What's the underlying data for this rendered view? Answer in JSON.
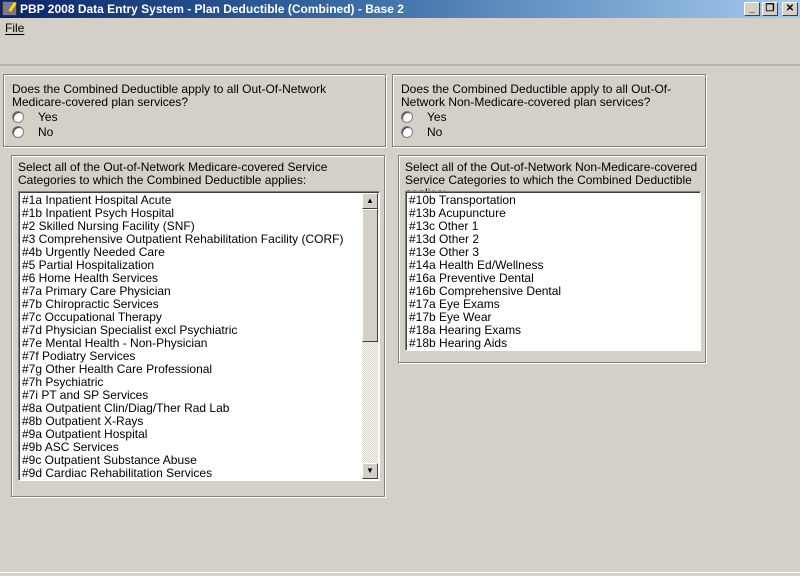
{
  "window": {
    "title": "PBP 2008 Data Entry System - Plan Deductible (Combined) - Base 2",
    "minimize": "_",
    "restore": "❐",
    "close": "✕"
  },
  "menu": {
    "file": "File"
  },
  "q_medicare": {
    "question": "Does the Combined Deductible apply to all Out-Of-Network Medicare-covered plan services?",
    "yes": "Yes",
    "no": "No"
  },
  "q_nonmedicare": {
    "question": "Does the Combined Deductible apply to all Out-Of-Network Non-Medicare-covered plan services?",
    "yes": "Yes",
    "no": "No"
  },
  "list_medicare": {
    "label": "Select all of the Out-of-Network Medicare-covered Service Categories to which the Combined Deductible applies:",
    "items": [
      "#1a Inpatient Hospital Acute",
      "#1b Inpatient Psych Hospital",
      "#2 Skilled Nursing Facility (SNF)",
      "#3 Comprehensive Outpatient Rehabilitation Facility (CORF)",
      "#4b Urgently Needed Care",
      "#5 Partial Hospitalization",
      "#6 Home Health Services",
      "#7a Primary Care Physician",
      "#7b Chiropractic Services",
      "#7c Occupational Therapy",
      "#7d Physician Specialist excl Psychiatric",
      "#7e Mental Health - Non-Physician",
      "#7f Podiatry Services",
      "#7g Other Health Care Professional",
      "#7h Psychiatric",
      "#7i PT and SP Services",
      "#8a Outpatient Clin/Diag/Ther Rad Lab",
      "#8b Outpatient X-Rays",
      "#9a Outpatient Hospital",
      "#9b ASC Services",
      "#9c Outpatient Substance Abuse",
      "#9d Cardiac Rehabilitation Services"
    ]
  },
  "list_nonmedicare": {
    "label": "Select all of the Out-of-Network Non-Medicare-covered Service Categories to which the Combined Deductible applies:",
    "items": [
      "#10b Transportation",
      "#13b Acupuncture",
      "#13c Other 1",
      "#13d Other 2",
      "#13e Other 3",
      "#14a Health Ed/Wellness",
      "#16a Preventive Dental",
      "#16b Comprehensive Dental",
      "#17a Eye Exams",
      "#17b Eye Wear",
      "#18a Hearing Exams",
      "#18b Hearing Aids"
    ]
  }
}
